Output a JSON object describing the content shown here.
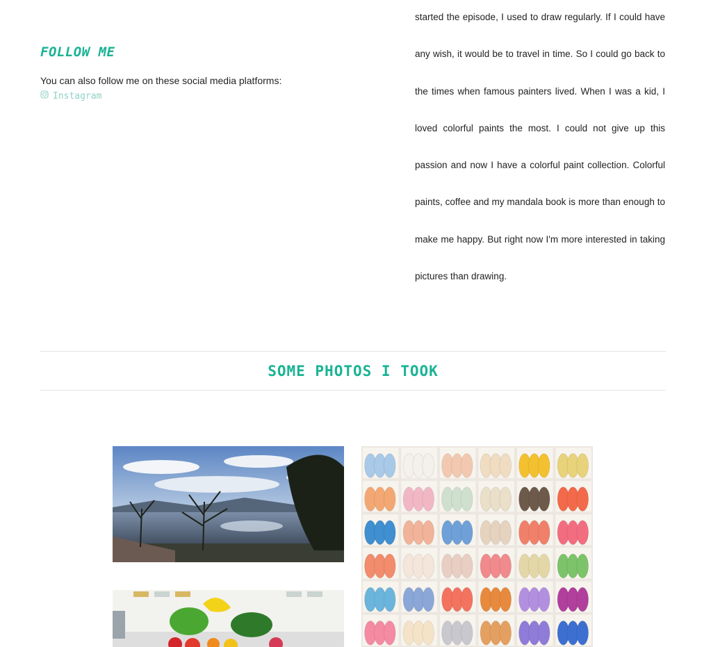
{
  "colors": {
    "accent": "#1ab394",
    "link": "#8fd1c4",
    "divider": "#e3e3e3"
  },
  "follow": {
    "title": "FOLLOW ME",
    "text": "You can also follow me on these social media platforms:",
    "instagram_label": "Instagram",
    "instagram_icon": "instagram-icon"
  },
  "story": {
    "text": "started the episode, I used to draw regularly. If I could have any wish, it would be to travel in time. So I could go back to the times when famous painters lived. When I was a kid, I loved colorful paints the most. I could not give up this passion and now I have a colorful paint collection. Colorful paints, coffee and my mandala book is more than enough to make me happy. But right now I'm more interested in taking pictures than drawing."
  },
  "photos": {
    "title": "SOME PHOTOS I TOOK",
    "items": [
      {
        "name": "lake-photo",
        "subject": "lake with bare trees"
      },
      {
        "name": "yarn-photo",
        "subject": "shelves of colorful yarn"
      },
      {
        "name": "fruit-photo",
        "subject": "basket of fruits and vegetables"
      }
    ],
    "yarn_colors": [
      [
        "#a9c9e8",
        "#f4f1ec",
        "#f2c9b0",
        "#f0dcc0",
        "#f3c12f",
        "#e8d27a"
      ],
      [
        "#f3a873",
        "#f1b8c4",
        "#cfe0cf",
        "#eadfc8",
        "#6d5a4a",
        "#f26a4a"
      ],
      [
        "#3f8fd1",
        "#f1b39a",
        "#6fa0d8",
        "#e6d3bf",
        "#f0806a",
        "#f26d7f"
      ],
      [
        "#f28c6c",
        "#f4e6da",
        "#e9cfc3",
        "#f08a8c",
        "#e4d7a7",
        "#7cc36a"
      ],
      [
        "#6bb5dc",
        "#8aa7d8",
        "#f3735f",
        "#e78a3e",
        "#b38fe0",
        "#b13f9c"
      ],
      [
        "#f58aa3",
        "#f5e3c8",
        "#c9c8cf",
        "#e4a060",
        "#8f7cd8",
        "#3d6fd0"
      ]
    ]
  }
}
